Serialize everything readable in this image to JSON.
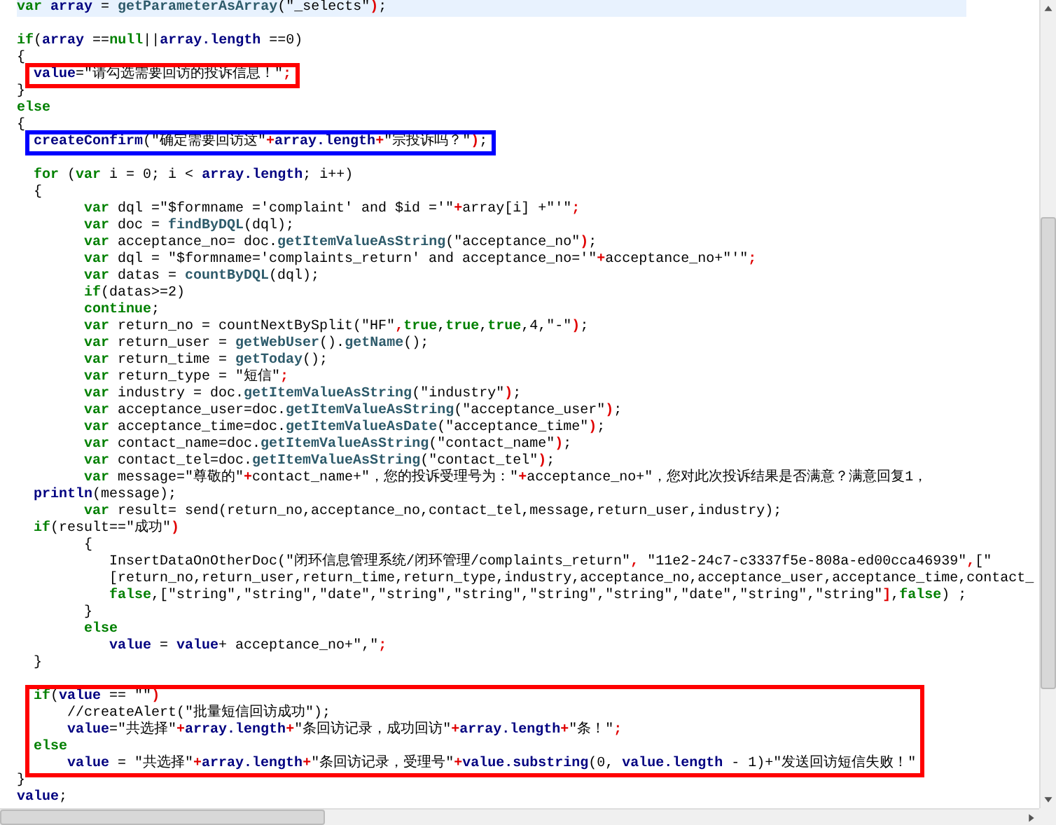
{
  "editor": {
    "blocks": [
      {
        "lines": [
          {
            "current": true,
            "tokens": [
              {
                "kind": "kw",
                "text": "var"
              },
              {
                "kind": "id",
                "text": " array"
              },
              {
                "kind": "tx",
                "text": " = "
              },
              {
                "kind": "fn",
                "text": "getParameterAsArray"
              },
              {
                "kind": "tx",
                "text": "(\"_selects\""
              },
              {
                "kind": "op",
                "text": ")"
              },
              {
                "kind": "tx",
                "text": ";"
              }
            ]
          },
          {
            "current": false
          },
          {
            "current": false,
            "tokens": [
              {
                "kind": "kw",
                "text": "if"
              },
              {
                "kind": "tx",
                "text": "("
              },
              {
                "kind": "id",
                "text": "array"
              },
              {
                "kind": "tx",
                "text": " =="
              },
              {
                "kind": "kw",
                "text": "null"
              },
              {
                "kind": "tx",
                "text": "||"
              },
              {
                "kind": "id",
                "text": "array.length"
              },
              {
                "kind": "tx",
                "text": " ==0)"
              }
            ]
          },
          {
            "current": false,
            "tokens": [
              {
                "kind": "tx",
                "text": "{"
              }
            ]
          }
        ]
      },
      {
        "color": "#ff0000",
        "lines": [
          {
            "current": false,
            "tokens": [
              {
                "kind": "id",
                "text": "value"
              },
              {
                "kind": "tx",
                "text": "=\"请勾选需要回访的投诉信息！\""
              },
              {
                "kind": "op",
                "text": ";"
              }
            ]
          }
        ]
      },
      {
        "lines": [
          {
            "current": false,
            "tokens": [
              {
                "kind": "tx",
                "text": "}"
              }
            ]
          },
          {
            "current": false,
            "tokens": [
              {
                "kind": "kw",
                "text": "else"
              }
            ]
          },
          {
            "current": false,
            "tokens": [
              {
                "kind": "tx",
                "text": "{"
              }
            ]
          }
        ]
      },
      {
        "color": "#0000ff",
        "lines": [
          {
            "current": false,
            "tokens": [
              {
                "kind": "id",
                "text": "createConfirm"
              },
              {
                "kind": "tx",
                "text": "(\"确定需要回访这\""
              },
              {
                "kind": "op",
                "text": "+"
              },
              {
                "kind": "id",
                "text": "array.length"
              },
              {
                "kind": "op",
                "text": "+"
              },
              {
                "kind": "tx",
                "text": "\"宗投诉吗？\""
              },
              {
                "kind": "op",
                "text": ")"
              },
              {
                "kind": "tx",
                "text": ";"
              }
            ]
          }
        ]
      },
      {
        "lines": [
          {
            "current": false
          },
          {
            "current": false,
            "tokens": [
              {
                "kind": "kw",
                "text": "  for"
              },
              {
                "kind": "tx",
                "text": " ("
              },
              {
                "kind": "kw",
                "text": "var"
              },
              {
                "kind": "tx",
                "text": " i = 0; i < "
              },
              {
                "kind": "id",
                "text": "array.length"
              },
              {
                "kind": "tx",
                "text": "; i++)"
              }
            ]
          },
          {
            "current": false,
            "tokens": [
              {
                "kind": "tx",
                "text": "  {"
              }
            ]
          },
          {
            "current": false,
            "tokens": [
              {
                "kind": "kw",
                "text": "        var"
              },
              {
                "kind": "tx",
                "text": " dql =\"$formname ='complaint' and $id ='\""
              },
              {
                "kind": "op",
                "text": "+"
              },
              {
                "kind": "tx",
                "text": "array[i] +\"'\""
              },
              {
                "kind": "op",
                "text": ";"
              }
            ]
          },
          {
            "current": false,
            "tokens": [
              {
                "kind": "kw",
                "text": "        var"
              },
              {
                "kind": "tx",
                "text": " doc = "
              },
              {
                "kind": "fn",
                "text": "findByDQL"
              },
              {
                "kind": "tx",
                "text": "(dql);"
              }
            ]
          },
          {
            "current": false,
            "tokens": [
              {
                "kind": "kw",
                "text": "        var"
              },
              {
                "kind": "tx",
                "text": " acceptance_no= doc."
              },
              {
                "kind": "fn",
                "text": "getItemValueAsString"
              },
              {
                "kind": "tx",
                "text": "(\"acceptance_no\""
              },
              {
                "kind": "op",
                "text": ")"
              },
              {
                "kind": "tx",
                "text": ";"
              }
            ]
          },
          {
            "current": false,
            "tokens": [
              {
                "kind": "kw",
                "text": "        var"
              },
              {
                "kind": "tx",
                "text": " dql = \"$formname='complaints_return' and acceptance_no='\""
              },
              {
                "kind": "op",
                "text": "+"
              },
              {
                "kind": "tx",
                "text": "acceptance_no+\"'\""
              },
              {
                "kind": "op",
                "text": ";"
              }
            ]
          },
          {
            "current": false,
            "tokens": [
              {
                "kind": "kw",
                "text": "        var"
              },
              {
                "kind": "tx",
                "text": " datas = "
              },
              {
                "kind": "fn",
                "text": "countByDQL"
              },
              {
                "kind": "tx",
                "text": "(dql);"
              }
            ]
          },
          {
            "current": false,
            "tokens": [
              {
                "kind": "kw",
                "text": "        if"
              },
              {
                "kind": "tx",
                "text": "(datas>=2)"
              }
            ]
          },
          {
            "current": false,
            "tokens": [
              {
                "kind": "kw",
                "text": "        continue"
              },
              {
                "kind": "tx",
                "text": ";"
              }
            ]
          },
          {
            "current": false,
            "tokens": [
              {
                "kind": "kw",
                "text": "        var"
              },
              {
                "kind": "tx",
                "text": " return_no = countNextBySplit(\"HF\""
              },
              {
                "kind": "op",
                "text": ","
              },
              {
                "kind": "kw",
                "text": "true"
              },
              {
                "kind": "tx",
                "text": ","
              },
              {
                "kind": "kw",
                "text": "true"
              },
              {
                "kind": "tx",
                "text": ","
              },
              {
                "kind": "kw",
                "text": "true"
              },
              {
                "kind": "tx",
                "text": ",4,\"-\""
              },
              {
                "kind": "op",
                "text": ")"
              },
              {
                "kind": "tx",
                "text": ";"
              }
            ]
          },
          {
            "current": false,
            "tokens": [
              {
                "kind": "kw",
                "text": "        var"
              },
              {
                "kind": "tx",
                "text": " return_user = "
              },
              {
                "kind": "fn",
                "text": "getWebUser"
              },
              {
                "kind": "tx",
                "text": "()."
              },
              {
                "kind": "fn",
                "text": "getName"
              },
              {
                "kind": "tx",
                "text": "();"
              }
            ]
          },
          {
            "current": false,
            "tokens": [
              {
                "kind": "kw",
                "text": "        var"
              },
              {
                "kind": "tx",
                "text": " return_time = "
              },
              {
                "kind": "fn",
                "text": "getToday"
              },
              {
                "kind": "tx",
                "text": "();"
              }
            ]
          },
          {
            "current": false,
            "tokens": [
              {
                "kind": "kw",
                "text": "        var"
              },
              {
                "kind": "tx",
                "text": " return_type = \"短信\""
              },
              {
                "kind": "op",
                "text": ";"
              }
            ]
          },
          {
            "current": false,
            "tokens": [
              {
                "kind": "kw",
                "text": "        var"
              },
              {
                "kind": "tx",
                "text": " industry = doc."
              },
              {
                "kind": "fn",
                "text": "getItemValueAsString"
              },
              {
                "kind": "tx",
                "text": "(\"industry\""
              },
              {
                "kind": "op",
                "text": ")"
              },
              {
                "kind": "tx",
                "text": ";"
              }
            ]
          },
          {
            "current": false,
            "tokens": [
              {
                "kind": "kw",
                "text": "        var"
              },
              {
                "kind": "tx",
                "text": " acceptance_user=doc."
              },
              {
                "kind": "fn",
                "text": "getItemValueAsString"
              },
              {
                "kind": "tx",
                "text": "(\"acceptance_user\""
              },
              {
                "kind": "op",
                "text": ")"
              },
              {
                "kind": "tx",
                "text": ";"
              }
            ]
          },
          {
            "current": false,
            "tokens": [
              {
                "kind": "kw",
                "text": "        var"
              },
              {
                "kind": "tx",
                "text": " acceptance_time=doc."
              },
              {
                "kind": "fn",
                "text": "getItemValueAsDate"
              },
              {
                "kind": "tx",
                "text": "(\"acceptance_time\""
              },
              {
                "kind": "op",
                "text": ")"
              },
              {
                "kind": "tx",
                "text": ";"
              }
            ]
          },
          {
            "current": false,
            "tokens": [
              {
                "kind": "kw",
                "text": "        var"
              },
              {
                "kind": "tx",
                "text": " contact_name=doc."
              },
              {
                "kind": "fn",
                "text": "getItemValueAsString"
              },
              {
                "kind": "tx",
                "text": "(\"contact_name\""
              },
              {
                "kind": "op",
                "text": ")"
              },
              {
                "kind": "tx",
                "text": ";"
              }
            ]
          },
          {
            "current": false,
            "tokens": [
              {
                "kind": "kw",
                "text": "        var"
              },
              {
                "kind": "tx",
                "text": " contact_tel=doc."
              },
              {
                "kind": "fn",
                "text": "getItemValueAsString"
              },
              {
                "kind": "tx",
                "text": "(\"contact_tel\""
              },
              {
                "kind": "op",
                "text": ")"
              },
              {
                "kind": "tx",
                "text": ";"
              }
            ]
          },
          {
            "current": false,
            "tokens": [
              {
                "kind": "kw",
                "text": "        var"
              },
              {
                "kind": "tx",
                "text": " message=\"尊敬的\""
              },
              {
                "kind": "op",
                "text": "+"
              },
              {
                "kind": "tx",
                "text": "contact_name+\"，您的投诉受理号为：\""
              },
              {
                "kind": "op",
                "text": "+"
              },
              {
                "kind": "tx",
                "text": "acceptance_no+\"，您对此次投诉结果是否满意？满意回复1，"
              }
            ]
          },
          {
            "current": false,
            "tokens": [
              {
                "kind": "id",
                "text": "  println"
              },
              {
                "kind": "tx",
                "text": "(message);"
              }
            ]
          },
          {
            "current": false,
            "tokens": [
              {
                "kind": "kw",
                "text": "        var"
              },
              {
                "kind": "tx",
                "text": " result= send(return_no,acceptance_no,contact_tel,message,return_user,industry);"
              }
            ]
          },
          {
            "current": false,
            "tokens": [
              {
                "kind": "kw",
                "text": "  if"
              },
              {
                "kind": "tx",
                "text": "(result==\"成功\""
              },
              {
                "kind": "op",
                "text": ")"
              }
            ]
          },
          {
            "current": false,
            "tokens": [
              {
                "kind": "tx",
                "text": "        {"
              }
            ]
          },
          {
            "current": false,
            "tokens": [
              {
                "kind": "tx",
                "text": "           InsertDataOnOtherDoc(\"闭环信息管理系统/闭环管理/complaints_return\""
              },
              {
                "kind": "op",
                "text": ","
              },
              {
                "kind": "tx",
                "text": " \"11e2-24c7-c3337f5e-808a-ed00cca46939\""
              },
              {
                "kind": "op",
                "text": ","
              },
              {
                "kind": "tx",
                "text": "[\""
              }
            ]
          },
          {
            "current": false,
            "tokens": [
              {
                "kind": "tx",
                "text": "           [return_no,return_user,return_time,return_type,industry,acceptance_no,acceptance_user,acceptance_time,contact_"
              }
            ]
          },
          {
            "current": false,
            "tokens": [
              {
                "kind": "kw",
                "text": "           false"
              },
              {
                "kind": "tx",
                "text": ",[\"string\",\"string\",\"date\",\"string\",\"string\",\"string\",\"string\",\"date\",\"string\",\"string\""
              },
              {
                "kind": "op",
                "text": "]"
              },
              {
                "kind": "tx",
                "text": ","
              },
              {
                "kind": "kw",
                "text": "false"
              },
              {
                "kind": "tx",
                "text": ") ;"
              }
            ]
          },
          {
            "current": false,
            "tokens": [
              {
                "kind": "tx",
                "text": "        }"
              }
            ]
          },
          {
            "current": false,
            "tokens": [
              {
                "kind": "kw",
                "text": "        else"
              }
            ]
          },
          {
            "current": false,
            "tokens": [
              {
                "kind": "id",
                "text": "           value"
              },
              {
                "kind": "tx",
                "text": " = "
              },
              {
                "kind": "id",
                "text": "value"
              },
              {
                "kind": "tx",
                "text": "+ acceptance_no+\",\""
              },
              {
                "kind": "op",
                "text": ";"
              }
            ]
          },
          {
            "current": false,
            "tokens": [
              {
                "kind": "tx",
                "text": "  }"
              }
            ]
          },
          {
            "current": false
          }
        ]
      },
      {
        "color": "#ff0000",
        "lines": [
          {
            "current": false,
            "tokens": [
              {
                "kind": "kw",
                "text": "if"
              },
              {
                "kind": "tx",
                "text": "("
              },
              {
                "kind": "id",
                "text": "value"
              },
              {
                "kind": "tx",
                "text": " == \"\""
              },
              {
                "kind": "op",
                "text": ")"
              }
            ]
          },
          {
            "current": false,
            "tokens": [
              {
                "kind": "tx",
                "text": "    //createAlert(\"批量短信回访成功\");"
              }
            ]
          },
          {
            "current": false,
            "tokens": [
              {
                "kind": "id",
                "text": "    value"
              },
              {
                "kind": "tx",
                "text": "=\"共选择\""
              },
              {
                "kind": "op",
                "text": "+"
              },
              {
                "kind": "id",
                "text": "array.length"
              },
              {
                "kind": "op",
                "text": "+"
              },
              {
                "kind": "tx",
                "text": "\"条回访记录，成功回访\""
              },
              {
                "kind": "op",
                "text": "+"
              },
              {
                "kind": "id",
                "text": "array.length"
              },
              {
                "kind": "op",
                "text": "+"
              },
              {
                "kind": "tx",
                "text": "\"条！\""
              },
              {
                "kind": "op",
                "text": ";"
              }
            ]
          },
          {
            "current": false,
            "tokens": [
              {
                "kind": "kw",
                "text": "else"
              }
            ]
          },
          {
            "current": false,
            "tokens": [
              {
                "kind": "id",
                "text": "    value"
              },
              {
                "kind": "tx",
                "text": " = \"共选择\""
              },
              {
                "kind": "op",
                "text": "+"
              },
              {
                "kind": "id",
                "text": "array.length"
              },
              {
                "kind": "op",
                "text": "+"
              },
              {
                "kind": "tx",
                "text": "\"条回访记录，受理号\""
              },
              {
                "kind": "op",
                "text": "+"
              },
              {
                "kind": "id",
                "text": "value.substring"
              },
              {
                "kind": "tx",
                "text": "(0, "
              },
              {
                "kind": "id",
                "text": "value.length"
              },
              {
                "kind": "tx",
                "text": " - 1)+\"发送回访短信失败！\""
              }
            ]
          }
        ]
      },
      {
        "lines": [
          {
            "current": false,
            "tokens": [
              {
                "kind": "tx",
                "text": "}"
              }
            ]
          },
          {
            "current": false,
            "tokens": [
              {
                "kind": "id",
                "text": "value"
              },
              {
                "kind": "tx",
                "text": ";"
              }
            ]
          }
        ]
      }
    ]
  }
}
